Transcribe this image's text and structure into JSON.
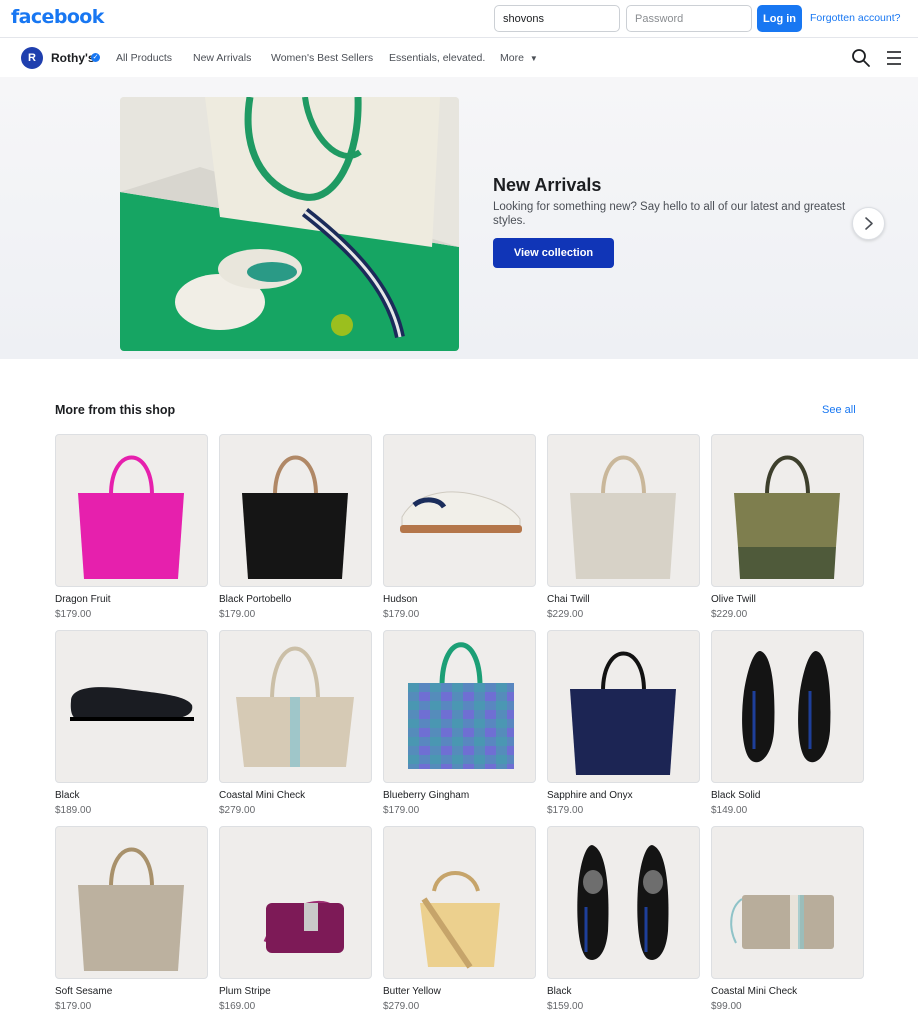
{
  "fb": {
    "logo": "facebook",
    "email_value": "shovons",
    "password_placeholder": "Password",
    "login_label": "Log in",
    "forgot_label": "Forgotten account?"
  },
  "shop": {
    "logo_text": "R",
    "name": "Rothy's",
    "nav": [
      "All Products",
      "New Arrivals",
      "Women's Best Sellers",
      "Essentials, elevated.",
      "More"
    ]
  },
  "hero": {
    "title": "New Arrivals",
    "subtitle": "Looking for something new? Say hello to all of our latest and greatest styles.",
    "button": "View collection"
  },
  "section": {
    "title": "More from this shop",
    "see_all": "See all"
  },
  "products": [
    {
      "name": "Dragon Fruit",
      "price": "$179.00",
      "kind": "tote",
      "color": "#e620ad",
      "handle": "#e620ad",
      "accent": "#e620ad"
    },
    {
      "name": "Black Portobello",
      "price": "$179.00",
      "kind": "tote",
      "color": "#151515",
      "handle": "#b08866",
      "accent": "#151515"
    },
    {
      "name": "Hudson",
      "price": "$179.00",
      "kind": "sneaker",
      "color": "#f1efe9",
      "handle": "#1b2d5c",
      "accent": "#b4764a"
    },
    {
      "name": "Chai Twill",
      "price": "$229.00",
      "kind": "tote",
      "color": "#d7d2c7",
      "handle": "#c9b79a",
      "accent": "#d7d2c7"
    },
    {
      "name": "Olive Twill",
      "price": "$229.00",
      "kind": "tote2",
      "color": "#7e7e4e",
      "handle": "#3d3f2c",
      "accent": "#4f5a3a"
    },
    {
      "name": "Black",
      "price": "$189.00",
      "kind": "loafer",
      "color": "#1a1c22",
      "handle": "#1a1c22",
      "accent": "#2a2d36"
    },
    {
      "name": "Coastal Mini Check",
      "price": "$279.00",
      "kind": "tote3",
      "color": "#d6cab5",
      "handle": "#cbbfa7",
      "accent": "#9fc6c9"
    },
    {
      "name": "Blueberry Gingham",
      "price": "$179.00",
      "kind": "gingham",
      "color": "#6f6fd3",
      "handle": "#1c9f76",
      "accent": "#3fa4a8"
    },
    {
      "name": "Sapphire and Onyx",
      "price": "$179.00",
      "kind": "tote",
      "color": "#1c2554",
      "handle": "#121212",
      "accent": "#1c2554"
    },
    {
      "name": "Black Solid",
      "price": "$149.00",
      "kind": "flats",
      "color": "#141414",
      "handle": "#1e3f9a",
      "accent": "#141414"
    },
    {
      "name": "Soft Sesame",
      "price": "$179.00",
      "kind": "tote",
      "color": "#bcb19f",
      "handle": "#a8916b",
      "accent": "#bcb19f"
    },
    {
      "name": "Plum Stripe",
      "price": "$169.00",
      "kind": "crossbody",
      "color": "#7d1a57",
      "handle": "#9b2d72",
      "accent": "#c9c9c9"
    },
    {
      "name": "Butter Yellow",
      "price": "$279.00",
      "kind": "bucket",
      "color": "#ecd08e",
      "handle": "#c6a46a",
      "accent": "#ecd08e"
    },
    {
      "name": "Black",
      "price": "$159.00",
      "kind": "flats2",
      "color": "#141414",
      "handle": "#1e3f9a",
      "accent": "#6e6e6e"
    },
    {
      "name": "Coastal Mini Check",
      "price": "$99.00",
      "kind": "pouch",
      "color": "#b8ad9b",
      "handle": "#8fc3c8",
      "accent": "#e8e3da"
    }
  ]
}
